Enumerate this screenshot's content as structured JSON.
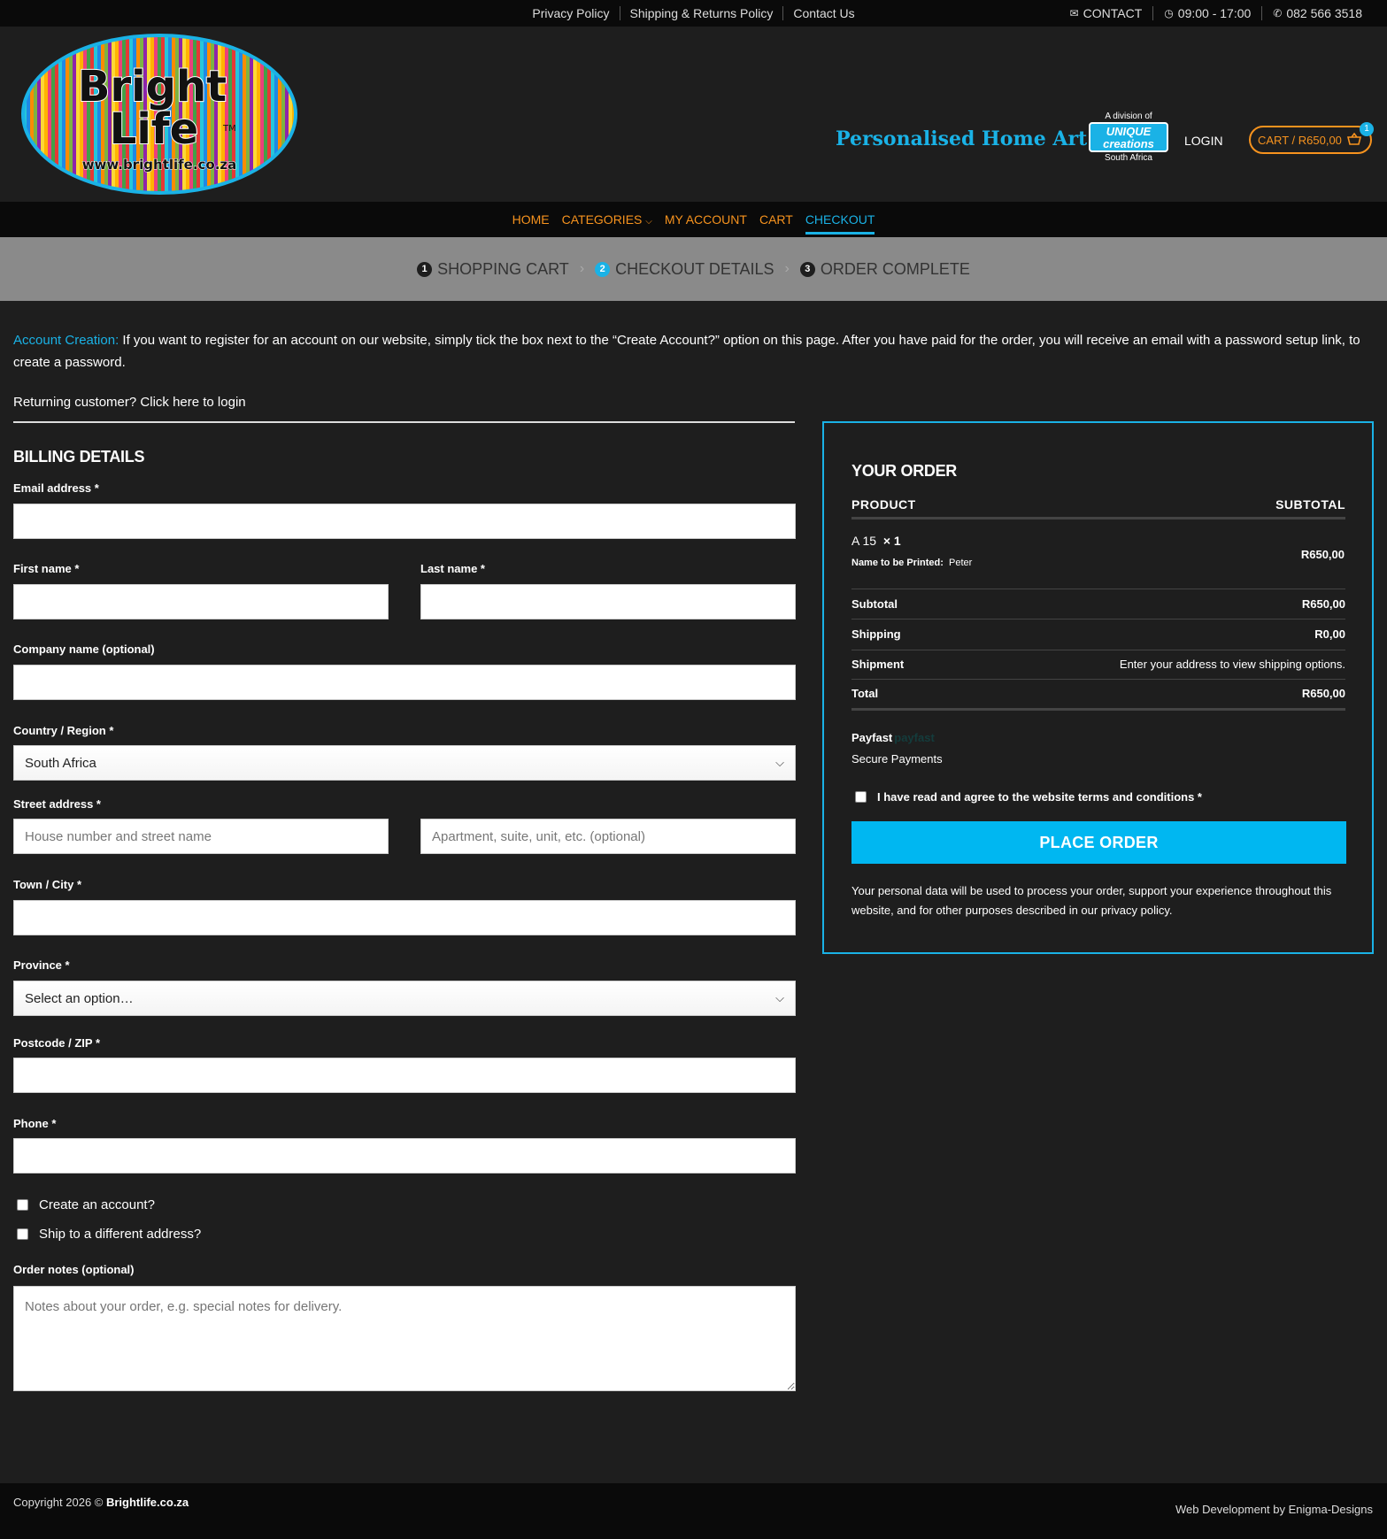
{
  "topbar": {
    "links": [
      "Privacy Policy",
      "Shipping & Returns Policy",
      "Contact Us"
    ],
    "contact_label": "CONTACT",
    "hours": "09:00 - 17:00",
    "phone": "082 566 3518"
  },
  "header": {
    "logo_line1": "Bright",
    "logo_line2": "Life",
    "logo_url": "www.brightlife.co.za",
    "logo_tm": "TM",
    "tagline": "Personalised Home Art",
    "division_text": "A division of",
    "division_brand_1": "UNIQUE",
    "division_brand_2": "creations",
    "division_country": "South Africa",
    "login": "LOGIN",
    "cart_label": "CART / R650,00",
    "cart_count": "1"
  },
  "nav": {
    "items": [
      "HOME",
      "CATEGORIES",
      "MY ACCOUNT",
      "CART",
      "CHECKOUT"
    ],
    "active": "CHECKOUT"
  },
  "steps": [
    {
      "num": "1",
      "label": "SHOPPING CART"
    },
    {
      "num": "2",
      "label": "CHECKOUT DETAILS"
    },
    {
      "num": "3",
      "label": "ORDER COMPLETE"
    }
  ],
  "notice": {
    "label": "Account Creation:",
    "text": " If you want to register for an account on our website, simply tick the box next to the “Create Account?” option on this page. After you have paid for the order, you will receive an email with a password setup link, to create a password.",
    "returning": "Returning customer? Click here to login"
  },
  "billing": {
    "title": "BILLING DETAILS",
    "email_label": "Email address *",
    "first_name_label": "First name *",
    "last_name_label": "Last name *",
    "company_label": "Company name (optional)",
    "country_label": "Country / Region *",
    "country_value": "South Africa",
    "street_label": "Street address *",
    "street_placeholder": "House number and street name",
    "street2_placeholder": "Apartment, suite, unit, etc. (optional)",
    "city_label": "Town / City *",
    "province_label": "Province *",
    "province_value": "Select an option…",
    "postcode_label": "Postcode / ZIP *",
    "phone_label": "Phone *",
    "create_account": "Create an account?",
    "ship_different": "Ship to a different address?",
    "notes_label": "Order notes (optional)",
    "notes_placeholder": "Notes about your order, e.g. special notes for delivery."
  },
  "order": {
    "title": "YOUR ORDER",
    "col_product": "PRODUCT",
    "col_subtotal": "SUBTOTAL",
    "product_name": "A 15",
    "product_qty": "× 1",
    "meta_label": "Name to be Printed:",
    "meta_value": "Peter",
    "product_price": "R650,00",
    "subtotal_label": "Subtotal",
    "subtotal_value": "R650,00",
    "shipping_label": "Shipping",
    "shipping_value": "R0,00",
    "shipment_label": "Shipment",
    "shipment_value": "Enter your address to view shipping options.",
    "total_label": "Total",
    "total_value": "R650,00",
    "payment_method": "Payfast",
    "payment_brand": "payfast",
    "secure": "Secure Payments",
    "terms": "I have read and agree to the website terms and conditions *",
    "place_order": "PLACE ORDER",
    "privacy": "Your personal data will be used to process your order, support your experience throughout this website, and for other purposes described in our privacy policy."
  },
  "footer": {
    "copyright_prefix": "Copyright 2026 © ",
    "copyright_site": "Brightlife.co.za",
    "webdev": "Web Development by Enigma-Designs"
  },
  "colors": {
    "accent_blue": "#1ab2e6",
    "accent_orange": "#f7931e",
    "button_blue": "#00b7f1"
  }
}
